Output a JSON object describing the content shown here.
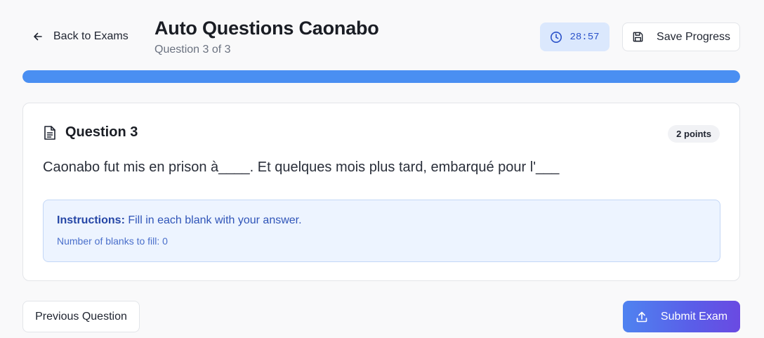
{
  "header": {
    "back_label": "Back to Exams",
    "title": "Auto Questions Caonabo",
    "subtitle": "Question 3 of 3",
    "timer": "28:57",
    "save_label": "Save Progress"
  },
  "progress": {
    "value": 1.0
  },
  "question": {
    "title": "Question 3",
    "points": "2 points",
    "text": "Caonabo fut mis en prison à____. Et quelques mois plus tard, embarqué pour l'___"
  },
  "instructions": {
    "label": "Instructions:",
    "text": " Fill in each blank with your answer.",
    "blanks": "Number of blanks to fill: 0"
  },
  "footer": {
    "previous_label": "Previous Question",
    "submit_label": "Submit Exam"
  },
  "colors": {
    "accent": "#4a8ff2",
    "timer_bg": "#dbe8fd",
    "submit_start": "#4f83f0",
    "submit_end": "#6a4ae2"
  },
  "icons": {
    "back": "arrow-left-icon",
    "timer": "clock-icon",
    "save": "save-icon",
    "question": "document-icon",
    "submit": "upload-icon"
  }
}
